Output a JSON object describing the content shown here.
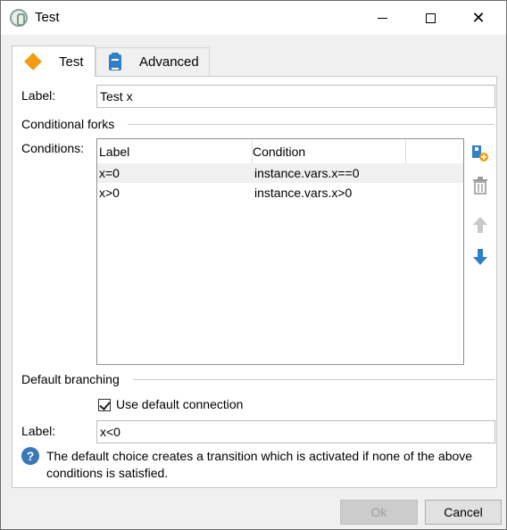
{
  "window": {
    "title": "Test"
  },
  "tabs": [
    {
      "label": "Test",
      "icon": "diamond-icon"
    },
    {
      "label": "Advanced",
      "icon": "clipboard-icon"
    }
  ],
  "form": {
    "label_caption": "Label:",
    "label_value": "Test x"
  },
  "conditional_forks": {
    "heading": "Conditional forks",
    "conditions_caption": "Conditions:",
    "columns": [
      "Label",
      "Condition"
    ],
    "rows": [
      {
        "label": "x=0",
        "condition": "instance.vars.x==0",
        "selected": true
      },
      {
        "label": "x>0",
        "condition": "instance.vars.x>0",
        "selected": false
      }
    ]
  },
  "default_branching": {
    "heading": "Default branching",
    "checkbox_label": "Use default connection",
    "checked": true,
    "label_caption": "Label:",
    "label_value": "x<0"
  },
  "help": {
    "text": "The default choice creates a transition which is activated if none of the above conditions is satisfied."
  },
  "buttons": {
    "ok": "Ok",
    "cancel": "Cancel"
  },
  "colors": {
    "accent_orange": "#f39c12",
    "accent_blue": "#2f7fc9"
  }
}
